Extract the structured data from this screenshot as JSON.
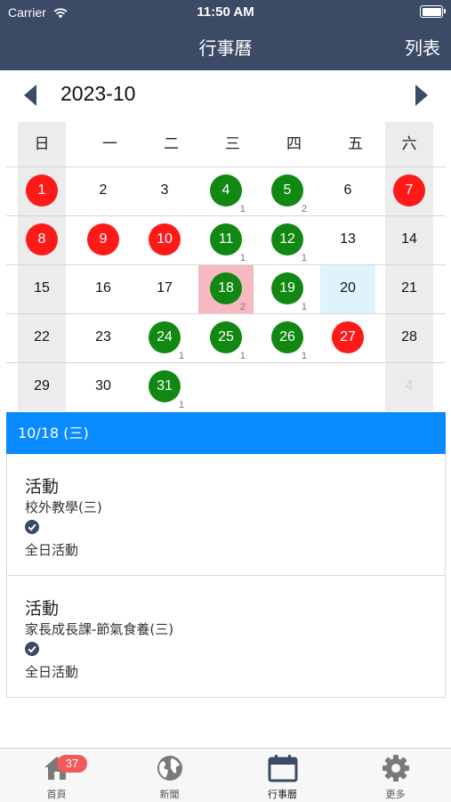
{
  "status_bar": {
    "carrier": "Carrier",
    "time": "11:50 AM",
    "battery_level": 1.0
  },
  "nav": {
    "title": "行事曆",
    "right_button": "列表"
  },
  "calendar": {
    "month": "2023-10",
    "weekdays": [
      "日",
      "一",
      "二",
      "三",
      "四",
      "五",
      "六"
    ],
    "weeks": [
      [
        {
          "day": "1",
          "mark": "red",
          "count": ""
        },
        {
          "day": "2",
          "mark": "",
          "count": ""
        },
        {
          "day": "3",
          "mark": "",
          "count": ""
        },
        {
          "day": "4",
          "mark": "green",
          "count": "1"
        },
        {
          "day": "5",
          "mark": "green",
          "count": "2"
        },
        {
          "day": "6",
          "mark": "",
          "count": ""
        },
        {
          "day": "7",
          "mark": "red",
          "count": ""
        }
      ],
      [
        {
          "day": "8",
          "mark": "red",
          "count": ""
        },
        {
          "day": "9",
          "mark": "red",
          "count": ""
        },
        {
          "day": "10",
          "mark": "red",
          "count": ""
        },
        {
          "day": "11",
          "mark": "green",
          "count": "1"
        },
        {
          "day": "12",
          "mark": "green",
          "count": "1"
        },
        {
          "day": "13",
          "mark": "",
          "count": ""
        },
        {
          "day": "14",
          "mark": "",
          "count": ""
        }
      ],
      [
        {
          "day": "15",
          "mark": "",
          "count": ""
        },
        {
          "day": "16",
          "mark": "",
          "count": ""
        },
        {
          "day": "17",
          "mark": "",
          "count": ""
        },
        {
          "day": "18",
          "mark": "green",
          "count": "2",
          "highlight": "selected"
        },
        {
          "day": "19",
          "mark": "green",
          "count": "1"
        },
        {
          "day": "20",
          "mark": "",
          "count": "",
          "highlight": "today"
        },
        {
          "day": "21",
          "mark": "",
          "count": ""
        }
      ],
      [
        {
          "day": "22",
          "mark": "",
          "count": ""
        },
        {
          "day": "23",
          "mark": "",
          "count": ""
        },
        {
          "day": "24",
          "mark": "green",
          "count": "1"
        },
        {
          "day": "25",
          "mark": "green",
          "count": "1"
        },
        {
          "day": "26",
          "mark": "green",
          "count": "1"
        },
        {
          "day": "27",
          "mark": "red",
          "count": ""
        },
        {
          "day": "28",
          "mark": "",
          "count": ""
        }
      ],
      [
        {
          "day": "29",
          "mark": "",
          "count": ""
        },
        {
          "day": "30",
          "mark": "",
          "count": ""
        },
        {
          "day": "31",
          "mark": "green",
          "count": "1"
        },
        {
          "day": "",
          "mark": "",
          "count": ""
        },
        {
          "day": "",
          "mark": "",
          "count": ""
        },
        {
          "day": "",
          "mark": "",
          "count": ""
        },
        {
          "day": "4",
          "mark": "faded",
          "count": ""
        }
      ]
    ]
  },
  "selected_day": {
    "label": "10/18 (三)"
  },
  "events": [
    {
      "type": "活動",
      "title": "校外教學(三)",
      "time": "全日活動"
    },
    {
      "type": "活動",
      "title": "家長成長課-節氣食養(三)",
      "time": "全日活動"
    }
  ],
  "tabbar": {
    "tabs": [
      {
        "label": "首頁",
        "icon": "home-icon",
        "badge": "37"
      },
      {
        "label": "新聞",
        "icon": "globe-icon",
        "badge": ""
      },
      {
        "label": "行事曆",
        "icon": "calendar-icon",
        "badge": ""
      },
      {
        "label": "更多",
        "icon": "gear-icon",
        "badge": ""
      }
    ]
  },
  "colors": {
    "header": "#3b4a65",
    "holiday": "#ff1a1a",
    "event": "#118811",
    "selected_bg": "#f9b9c2",
    "today_bg": "#dff3fb",
    "accent": "#0a8aff",
    "badge": "#f05a5a"
  }
}
